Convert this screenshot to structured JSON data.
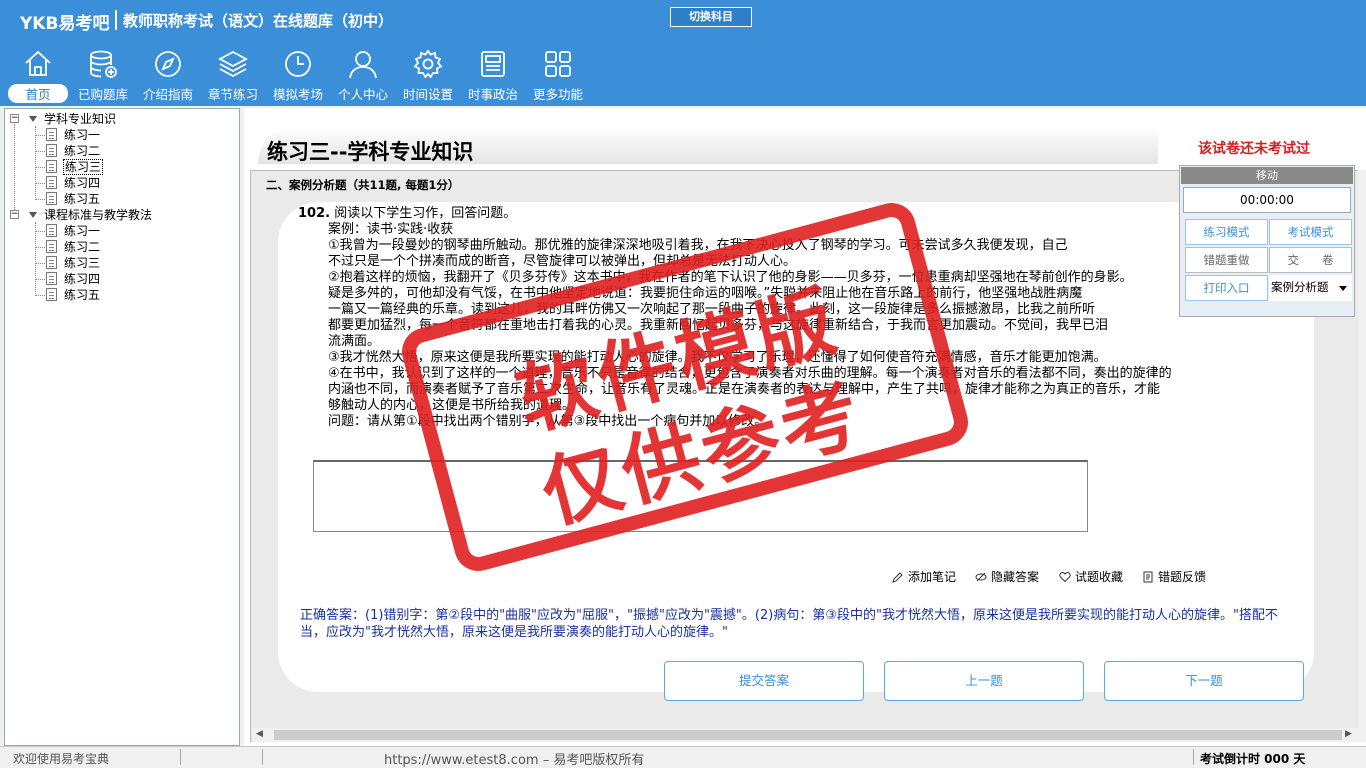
{
  "header": {
    "logo": "YKB易考吧",
    "title": "教师职称考试（语文）在线题库（初中）",
    "switch_label": "切换科目"
  },
  "nav": [
    {
      "label": "首页",
      "icon": "home-icon",
      "active": true
    },
    {
      "label": "已购题库",
      "icon": "database-add-icon"
    },
    {
      "label": "介绍指南",
      "icon": "compass-icon"
    },
    {
      "label": "章节练习",
      "icon": "layers-icon"
    },
    {
      "label": "模拟考场",
      "icon": "clock-icon"
    },
    {
      "label": "个人中心",
      "icon": "user-icon"
    },
    {
      "label": "时间设置",
      "icon": "gear-icon"
    },
    {
      "label": "时事政治",
      "icon": "newspaper-icon"
    },
    {
      "label": "更多功能",
      "icon": "grid-icon"
    }
  ],
  "tree": {
    "group1": {
      "label": "学科专业知识",
      "items": [
        "练习一",
        "练习二",
        "练习三",
        "练习四",
        "练习五"
      ]
    },
    "group2": {
      "label": "课程标准与教学教法",
      "items": [
        "练习一",
        "练习二",
        "练习三",
        "练习四",
        "练习五"
      ]
    }
  },
  "exam": {
    "title": "练习三--学科专业知识",
    "status": "该试卷还未考试过",
    "section": "二、案例分析题（共11题, 每题1分）"
  },
  "question": {
    "number": "102.",
    "prompt": "阅读以下学生习作，回答问题。",
    "lines": [
      "案例：读书·实践·收获",
      "①我曾为一段曼妙的钢琴曲所触动。那优雅的旋律深深地吸引着我，在我下决心投入了钢琴的学习。可未尝试多久我便发现，自己",
      "不过只是一个个拼凑而成的断音，尽管旋律可以被弹出，但却总是无法打动人心。",
      "②抱着这样的烦恼，我翻开了《贝多芬传》这本书中，我在作者的笔下认识了他的身影——贝多芬，一位患重病却坚强地在琴前创作的身影。",
      "疑是多舛的，可他却没有气馁，在书中他坚定地说道：我要扼住命运的咽喉。”失聪并未阻止他在音乐路上的前行，他坚强地战胜病魔",
      "一篇又一篇经典的乐章。读到这儿，我的耳畔仿佛又一次响起了那一段曲子的旋律。此刻，这一段旋律是多么振撼激昂，比我之前所听",
      "都要更加猛烈，每一个音符都在重地击打着我的心灵。我重新回忆起贝多芬，与这旋律重新结合，于我而言更加震动。不觉间，我早已泪",
      "流满面。",
      "③我才恍然大悟，原来这便是我所要实现的能打动人心的旋律。我不仅学习了乐理，还懂得了如何使音符充满情感，音乐才能更加饱满。",
      "④在书中，我认识到了这样的一个道理，音乐不只是音律的结合，更包含了演奏者对乐曲的理解。每一个演奏者对音乐的看法都不同，奏出的旋律的",
      "内涵也不同，而演奏者赋予了音乐第二次生命，让音乐有了灵魂。正是在演奏者的表达与理解中，产生了共鸣，旋律才能称之为真正的音乐，才能",
      "够触动人的内心，这便是书所给我的道理。",
      "问题：请从第①段中找出两个错别字，从第③段中找出一个病句并加以修改。"
    ]
  },
  "tools": {
    "add_note": "添加笔记",
    "hide_answer": "隐藏答案",
    "favorite": "试题收藏",
    "feedback": "错题反馈"
  },
  "answer": {
    "text": "正确答案：(1)错别字：第②段中的\"曲服\"应改为\"屈服\"，\"振撼\"应改为\"震撼\"。(2)病句：第③段中的\"我才恍然大悟，原来这便是我所要实现的能打动人心的旋律。\"搭配不当，应改为\"我才恍然大悟，原来这便是我所要演奏的能打动人心的旋律。\""
  },
  "buttons": {
    "submit": "提交答案",
    "prev": "上一题",
    "next": "下一题"
  },
  "float_panel": {
    "move": "移动",
    "timer": "00:00:00",
    "practice_mode": "练习模式",
    "exam_mode": "考试模式",
    "redo_wrong": "错题重做",
    "submit_paper": "交　　卷",
    "print": "打印入口",
    "type_select": "案例分析题"
  },
  "statusbar": {
    "welcome": "欢迎使用易考宝典",
    "url": "https://www.etest8.com – 易考吧版权所有",
    "countdown": "考试倒计时 000 天"
  },
  "watermark": {
    "line1": "软件模版",
    "line2": "仅供参考"
  },
  "colors": {
    "header_bg": "#3a8fd8",
    "accent": "#3a8fd8",
    "warning": "#d42020",
    "answer_text": "#1a2fa0",
    "stamp": "#e02020"
  }
}
